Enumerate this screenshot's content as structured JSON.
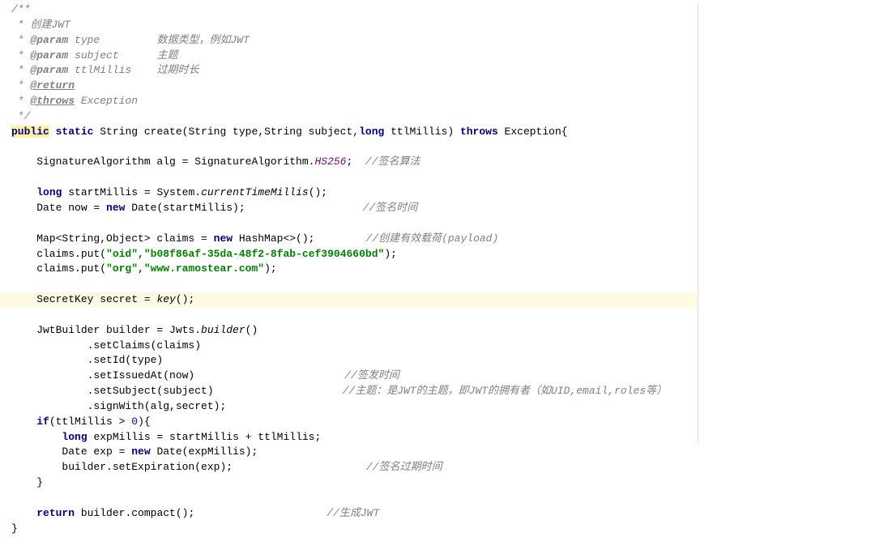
{
  "doc": {
    "open": "/**",
    "l1": " * 创建JWT",
    "l2_star": " * ",
    "l2_tag": "@param",
    "l2_name": " type",
    "l2_desc": "         数据类型，例如JWT",
    "l3_star": " * ",
    "l3_tag": "@param",
    "l3_name": " subject",
    "l3_desc": "      主题",
    "l4_star": " * ",
    "l4_tag": "@param",
    "l4_name": " ttlMillis",
    "l4_desc": "    过期时长",
    "l5_star": " * ",
    "l5_tag": "@return",
    "l6_star": " * ",
    "l6_tag": "@throws",
    "l6_desc": " Exception",
    "close": " */"
  },
  "sig": {
    "public": "public",
    "static": " static ",
    "ret": "String create(String type,String subject,",
    "long": "long",
    "param": " ttlMillis) ",
    "throws": "throws",
    "end": " Exception{"
  },
  "alg": {
    "type": "    SignatureAlgorithm alg = SignatureAlgorithm.",
    "field": "HS256",
    "semi": ";  ",
    "comment": "//签名算法"
  },
  "start": {
    "indent": "    ",
    "long": "long",
    "rest": " startMillis = System.",
    "method": "currentTimeMillis",
    "end": "();"
  },
  "now": {
    "pre": "    Date now = ",
    "new": "new",
    "rest": " Date(startMillis);",
    "comment": "//签名时间"
  },
  "map": {
    "pre": "    Map<String,Object> claims = ",
    "new": "new",
    "rest": " HashMap<>();",
    "comment": "//创建有效载荷(payload)"
  },
  "put1": {
    "pre": "    claims.put(",
    "k": "\"oid\"",
    "c": ",",
    "v": "\"b08f86af-35da-48f2-8fab-cef3904660bd\"",
    "end": ");"
  },
  "put2": {
    "pre": "    claims.put(",
    "k": "\"org\"",
    "c": ",",
    "v": "\"www.ramostear.com\"",
    "end": ");"
  },
  "secret": {
    "pre": "    SecretKey secret = ",
    "method": "key",
    "end": "();"
  },
  "builder": {
    "pre": "    JwtBuilder builder = Jwts.",
    "method": "builder",
    "end": "()"
  },
  "setClaims": "            .setClaims(claims)",
  "setId": "            .setId(type)",
  "setIssuedAt": {
    "code": "            .setIssuedAt(now)",
    "comment": "//签发时间"
  },
  "setSubject": {
    "code": "            .setSubject(subject)",
    "comment": "//主题：是JWT的主题，即JWT的拥有者（如UID,email,roles等）"
  },
  "signWith": "            .signWith(alg,secret);",
  "ifline": {
    "indent": "    ",
    "if": "if",
    "cond": "(ttlMillis > ",
    "zero": "0",
    "end": "){"
  },
  "exp1": {
    "indent": "        ",
    "long": "long",
    "rest": " expMillis = startMillis + ttlMillis;"
  },
  "exp2": {
    "pre": "        Date exp = ",
    "new": "new",
    "rest": " Date(expMillis);"
  },
  "exp3": {
    "code": "        builder.setExpiration(exp);",
    "comment": "//签名过期时间"
  },
  "closeif": "    }",
  "ret": {
    "indent": "    ",
    "return": "return",
    "rest": " builder.compact();",
    "comment": "//生成JWT"
  },
  "closefn": "}"
}
